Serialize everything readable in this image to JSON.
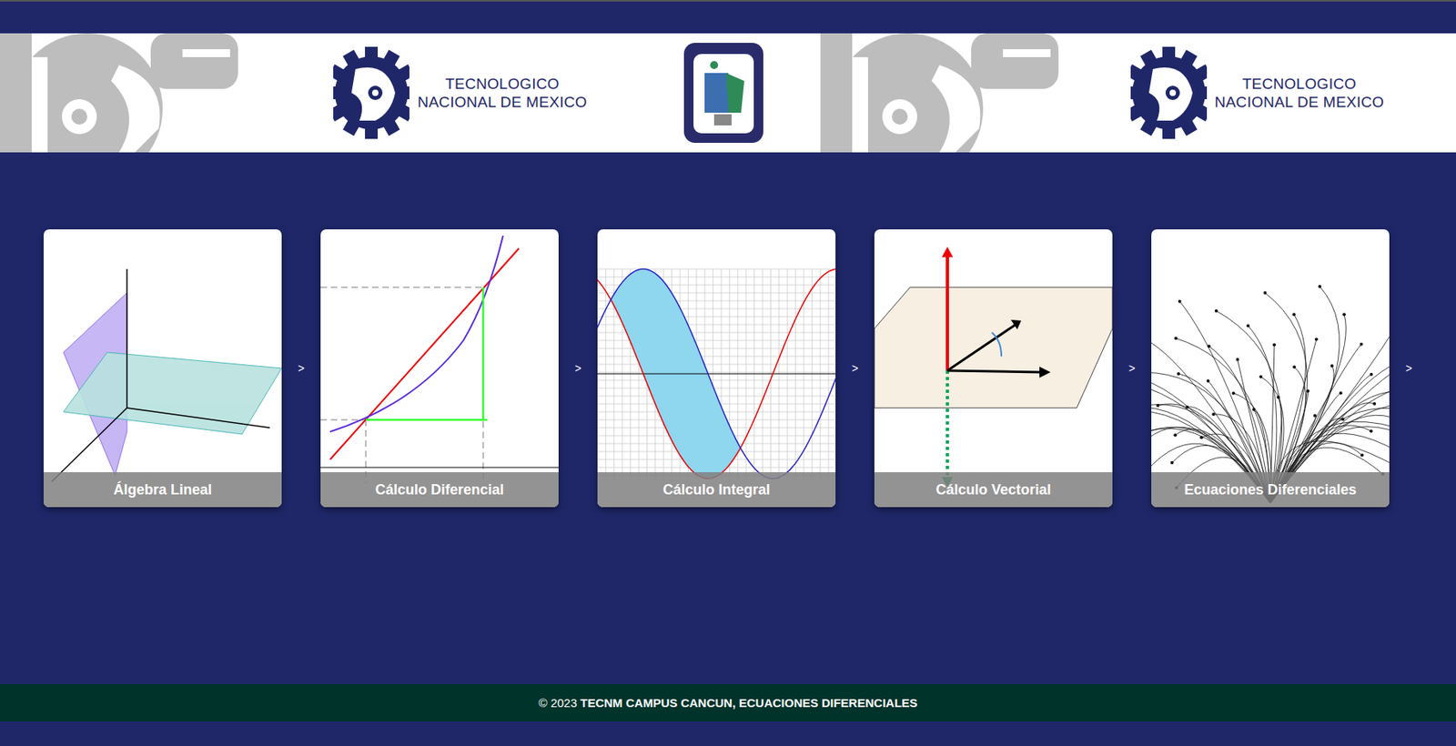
{
  "banner": {
    "logos": [
      {
        "line1": "TECNOLOGICO",
        "line2": "NACIONAL DE MEXICO"
      },
      {
        "line1": "TECNOLOGICO",
        "line2": "NACIONAL DE MEXICO"
      }
    ]
  },
  "cards": [
    {
      "title": "Álgebra Lineal",
      "kind": "planes",
      "separator": ">"
    },
    {
      "title": "Cálculo Diferencial",
      "kind": "derivative",
      "separator": ">"
    },
    {
      "title": "Cálculo Integral",
      "kind": "integral",
      "separator": ">"
    },
    {
      "title": "Cálculo Vectorial",
      "kind": "vectors",
      "separator": ">"
    },
    {
      "title": "Ecuaciones Diferenciales",
      "kind": "field",
      "separator": ">"
    }
  ],
  "footer": {
    "prefix": "© 2023",
    "text": "TECNM CAMPUS CANCUN, ECUACIONES DIFERENCIALES"
  }
}
